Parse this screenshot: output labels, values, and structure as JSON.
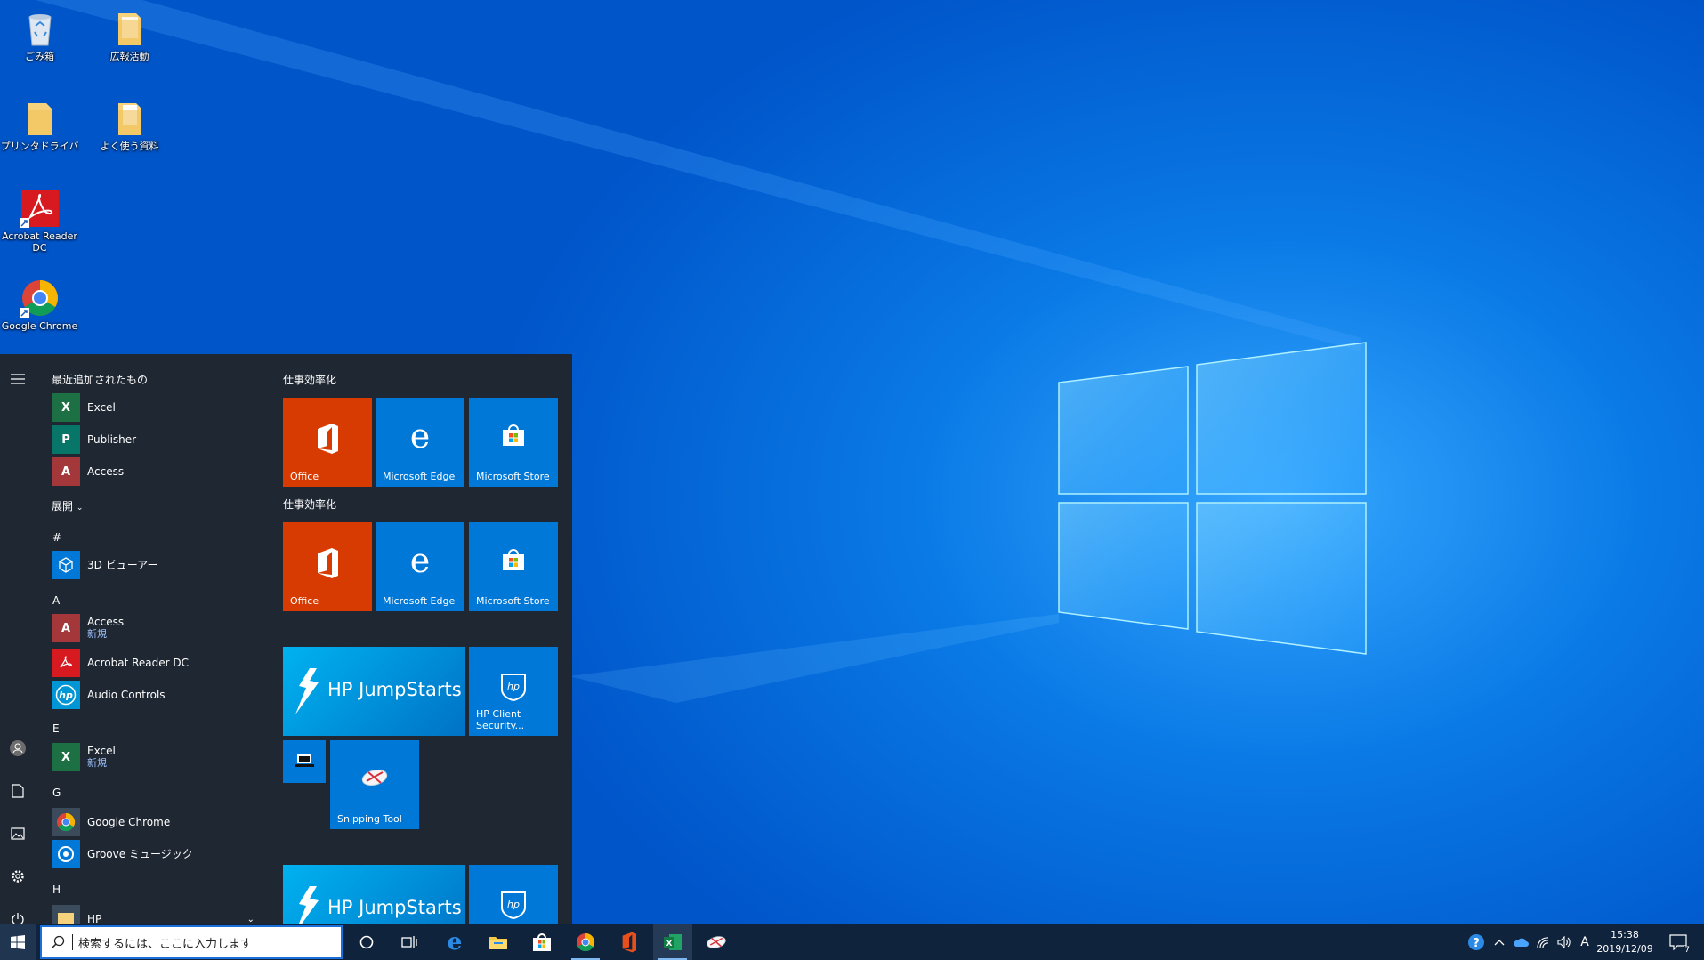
{
  "desktop": {
    "icons": [
      {
        "label": "ごみ箱",
        "icon": "recycle-bin-icon"
      },
      {
        "label": "広報活動",
        "icon": "folder-icon"
      },
      {
        "label": "プリンタドライバ",
        "icon": "folder-icon"
      },
      {
        "label": "よく使う資料",
        "icon": "folder-icon"
      },
      {
        "label": "Acrobat Reader DC",
        "icon": "acrobat-icon"
      },
      {
        "label": "Google Chrome",
        "icon": "chrome-icon"
      }
    ]
  },
  "start_menu": {
    "recent_header": "最近追加されたもの",
    "recent": [
      {
        "label": "Excel",
        "letter": "X",
        "color": "#1d7044"
      },
      {
        "label": "Publisher",
        "letter": "P",
        "color": "#077568"
      },
      {
        "label": "Access",
        "letter": "A",
        "color": "#a4373a"
      }
    ],
    "expand_label": "展開",
    "sections": [
      {
        "letter": "#",
        "apps": [
          {
            "label": "3D ビューアー",
            "sub": ""
          }
        ]
      },
      {
        "letter": "A",
        "apps": [
          {
            "label": "Access",
            "sub": "新規"
          },
          {
            "label": "Acrobat Reader DC",
            "sub": ""
          },
          {
            "label": "Audio Controls",
            "sub": ""
          }
        ]
      },
      {
        "letter": "E",
        "apps": [
          {
            "label": "Excel",
            "sub": "新規"
          }
        ]
      },
      {
        "letter": "G",
        "apps": [
          {
            "label": "Google Chrome",
            "sub": ""
          },
          {
            "label": "Groove ミュージック",
            "sub": ""
          }
        ]
      },
      {
        "letter": "H",
        "apps": [
          {
            "label": "HP",
            "sub": ""
          }
        ]
      }
    ],
    "tile_groups": [
      {
        "title": "仕事効率化",
        "tiles": [
          "Office",
          "Microsoft Edge",
          "Microsoft Store"
        ]
      },
      {
        "title": "仕事効率化",
        "tiles": [
          "Office",
          "Microsoft Edge",
          "Microsoft Store"
        ]
      }
    ],
    "hp_tiles": {
      "jumpstarts": "HP JumpStarts",
      "client_security": "HP Client Security...",
      "snipping": "Snipping Tool"
    }
  },
  "taskbar": {
    "search_placeholder": "検索するには、ここに入力します",
    "ime": "A",
    "time": "15:38",
    "date": "2019/12/09",
    "notifications": "7"
  },
  "colors": {
    "office": "#d83b01",
    "tile_blue": "#0078d7",
    "taskbar": "#10233c"
  }
}
